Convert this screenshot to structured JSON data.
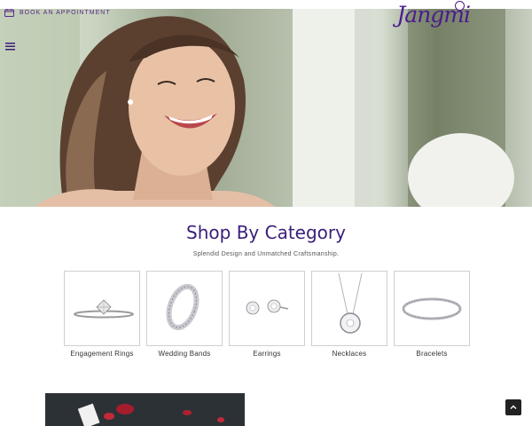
{
  "header": {
    "appointment_label": "BOOK AN APPOINTMENT",
    "logo_text": "Jangmi",
    "brand_color": "#4b1b8f"
  },
  "icons": {
    "appointment": "calendar-book-icon",
    "menu": "hamburger-menu-icon",
    "scroll_top": "chevron-up-icon"
  },
  "categories": {
    "title": "Shop By Category",
    "subtitle": "Splendid Design and Unmatched Craftsmanship.",
    "items": [
      {
        "label": "Engagement Rings"
      },
      {
        "label": "Wedding Bands"
      },
      {
        "label": "Earrings"
      },
      {
        "label": "Necklaces"
      },
      {
        "label": "Bracelets"
      }
    ]
  }
}
